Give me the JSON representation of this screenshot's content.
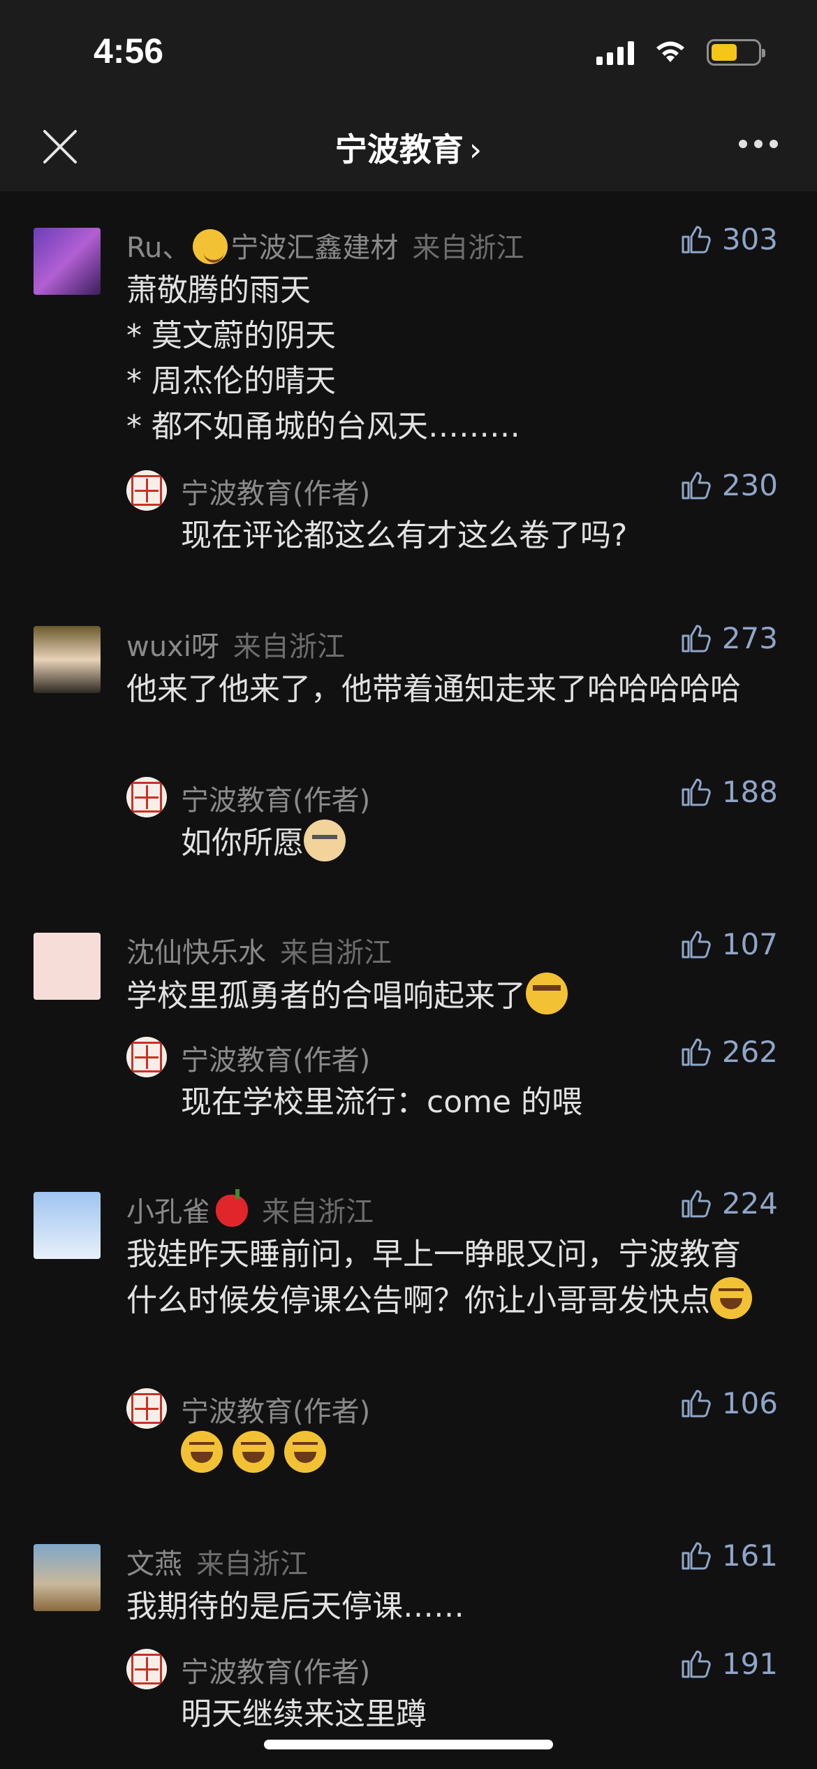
{
  "status_bar": {
    "time": "4:56",
    "battery_color": "#f5c518"
  },
  "nav": {
    "title": "宁波教育",
    "chevron": "›",
    "close_icon": "close-icon",
    "more_icon": "more-icon"
  },
  "comments": [
    {
      "user": "Ru、",
      "user_suffix": "宁波汇鑫建材",
      "from": "来自浙江",
      "likes": "303",
      "text_lines": [
        "萧敬腾的雨天",
        "* 莫文蔚的阴天",
        "* 周杰伦的晴天",
        "* 都不如甬城的台风天………"
      ],
      "reply": {
        "name": "宁波教育(作者)",
        "likes": "230",
        "text": "现在评论都这么有才这么卷了吗?"
      }
    },
    {
      "user": "wuxi呀",
      "from": "来自浙江",
      "likes": "273",
      "text": "他来了他来了，他带着通知走来了哈哈哈哈哈",
      "reply": {
        "name": "宁波教育(作者)",
        "likes": "188",
        "text": "如你所愿"
      }
    },
    {
      "user": "沈仙快乐水",
      "from": "来自浙江",
      "likes": "107",
      "text": "学校里孤勇者的合唱响起来了",
      "reply": {
        "name": "宁波教育(作者)",
        "likes": "262",
        "text": "现在学校里流行：come 的喂"
      }
    },
    {
      "user": "小孔雀",
      "from": "来自浙江",
      "likes": "224",
      "text": "我娃昨天睡前问，早上一睁眼又问，宁波教育什么时候发停课公告啊？你让小哥哥发快点",
      "reply": {
        "name": "宁波教育(作者)",
        "likes": "106",
        "text": ""
      }
    },
    {
      "user": "文燕",
      "from": "来自浙江",
      "likes": "161",
      "text": "我期待的是后天停课……",
      "reply": {
        "name": "宁波教育(作者)",
        "likes": "191",
        "text": "明天继续来这里蹲"
      }
    }
  ]
}
